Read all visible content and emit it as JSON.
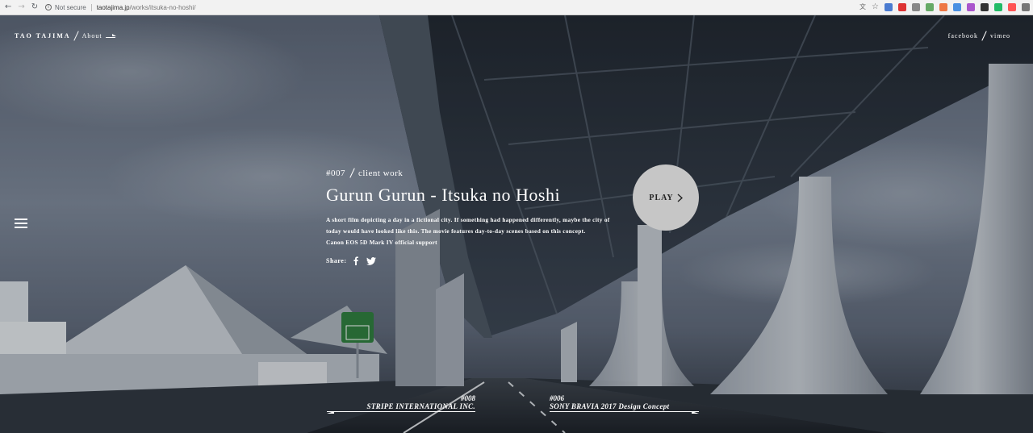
{
  "browser": {
    "security_label": "Not secure",
    "url_host": "taotajima.jp",
    "url_path": "/works/itsuka-no-hoshi/",
    "extension_colors": [
      "#4a7bd0",
      "#d33",
      "#888",
      "#6a6",
      "#e74",
      "#4a90e2",
      "#a5c",
      "#333",
      "#2b6",
      "#f55",
      "#777"
    ]
  },
  "site": {
    "brand": "TAO TAJIMA",
    "about_link": "About",
    "social": [
      "facebook",
      "vimeo"
    ]
  },
  "work": {
    "number": "#007",
    "category": "client work",
    "title": "Gurun Gurun - Itsuka no Hoshi",
    "description": "A short film depicting a day in a fictional city. If something had happened differently, maybe the city of today would have looked like this. The movie features day-to-day scenes based on this concept.",
    "support": "Canon EOS 5D Mark IV official support",
    "share_label": "Share:",
    "play_label": "PLAY"
  },
  "pager": {
    "prev": {
      "number": "#008",
      "label": "STRIPE INTERNATIONAL INC."
    },
    "next": {
      "number": "#006",
      "label": "SONY BRAVIA 2017 Design Concept"
    }
  },
  "colors": {
    "play_button": "#c6c6c6",
    "text": "#ffffff",
    "sign_green": "#2c7a3a"
  }
}
